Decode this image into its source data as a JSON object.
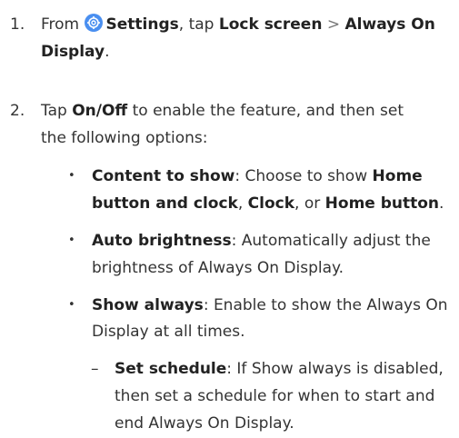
{
  "steps": [
    {
      "number": "1.",
      "from": "From",
      "settings": "Settings",
      "tap": ", tap",
      "lock_screen": "Lock screen",
      "chevron": ">",
      "always_on": "Always On",
      "display": "Display",
      "period": "."
    },
    {
      "number": "2.",
      "tap": "Tap",
      "on_off": "On/Off",
      "line1_rest": "to enable the feature, and then set",
      "line2": "the following options:"
    }
  ],
  "options": [
    {
      "bullet": "•",
      "label": "Content to show",
      "line1_rest": ": Choose to show",
      "home_button_line1": "Home",
      "home_button_line2": "button and clock",
      "comma1": ",",
      "clock": "Clock",
      "or": ", or",
      "home_button": "Home button",
      "period": "."
    },
    {
      "bullet": "•",
      "label": "Auto brightness",
      "line1_rest": ": Automatically adjust the",
      "line2": "brightness of Always On Display."
    },
    {
      "bullet": "•",
      "label": "Show always",
      "line1_rest": ": Enable to show the Always On",
      "line2": "Display at all times."
    }
  ],
  "sub_option": {
    "dash": "–",
    "label": "Set schedule",
    "line1_rest": ": If Show always is disabled,",
    "line2": "then set a schedule for when to start and",
    "line3": "end Always On Display."
  },
  "icons": {
    "settings": "settings-gear-icon"
  },
  "colors": {
    "settings_icon": "#4a8ff0"
  }
}
